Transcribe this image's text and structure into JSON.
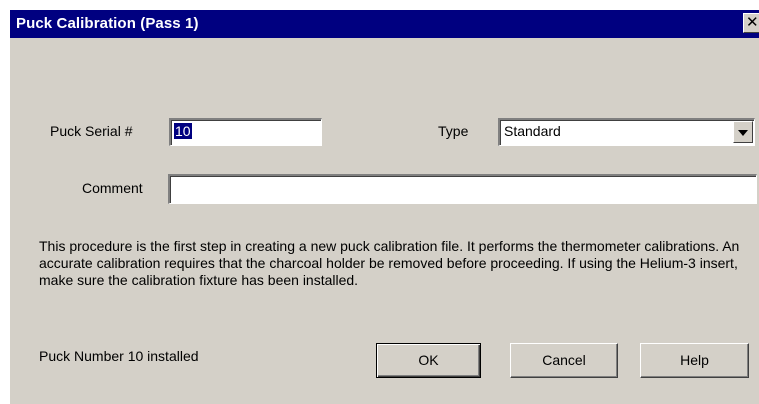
{
  "window": {
    "title": "Puck Calibration (Pass 1)",
    "close_symbol": "✕"
  },
  "form": {
    "serial_label": "Puck Serial #",
    "serial_value": "10",
    "type_label": "Type",
    "type_value": "Standard",
    "comment_label": "Comment",
    "comment_value": ""
  },
  "description": "This procedure is the first step in creating a new puck calibration file.  It performs the thermometer calibrations.  An accurate calibration requires that the charcoal holder be removed before proceeding.  If using the Helium-3 insert, make sure the calibration fixture has been installed.",
  "status": "Puck Number 10 installed",
  "buttons": {
    "ok": "OK",
    "cancel": "Cancel",
    "help": "Help"
  },
  "colors": {
    "titlebar": "#000080",
    "dialog_face": "#d4d0c8",
    "selection": "#000080"
  },
  "icons": {
    "close": "close-icon",
    "dropdown": "chevron-down-icon"
  }
}
